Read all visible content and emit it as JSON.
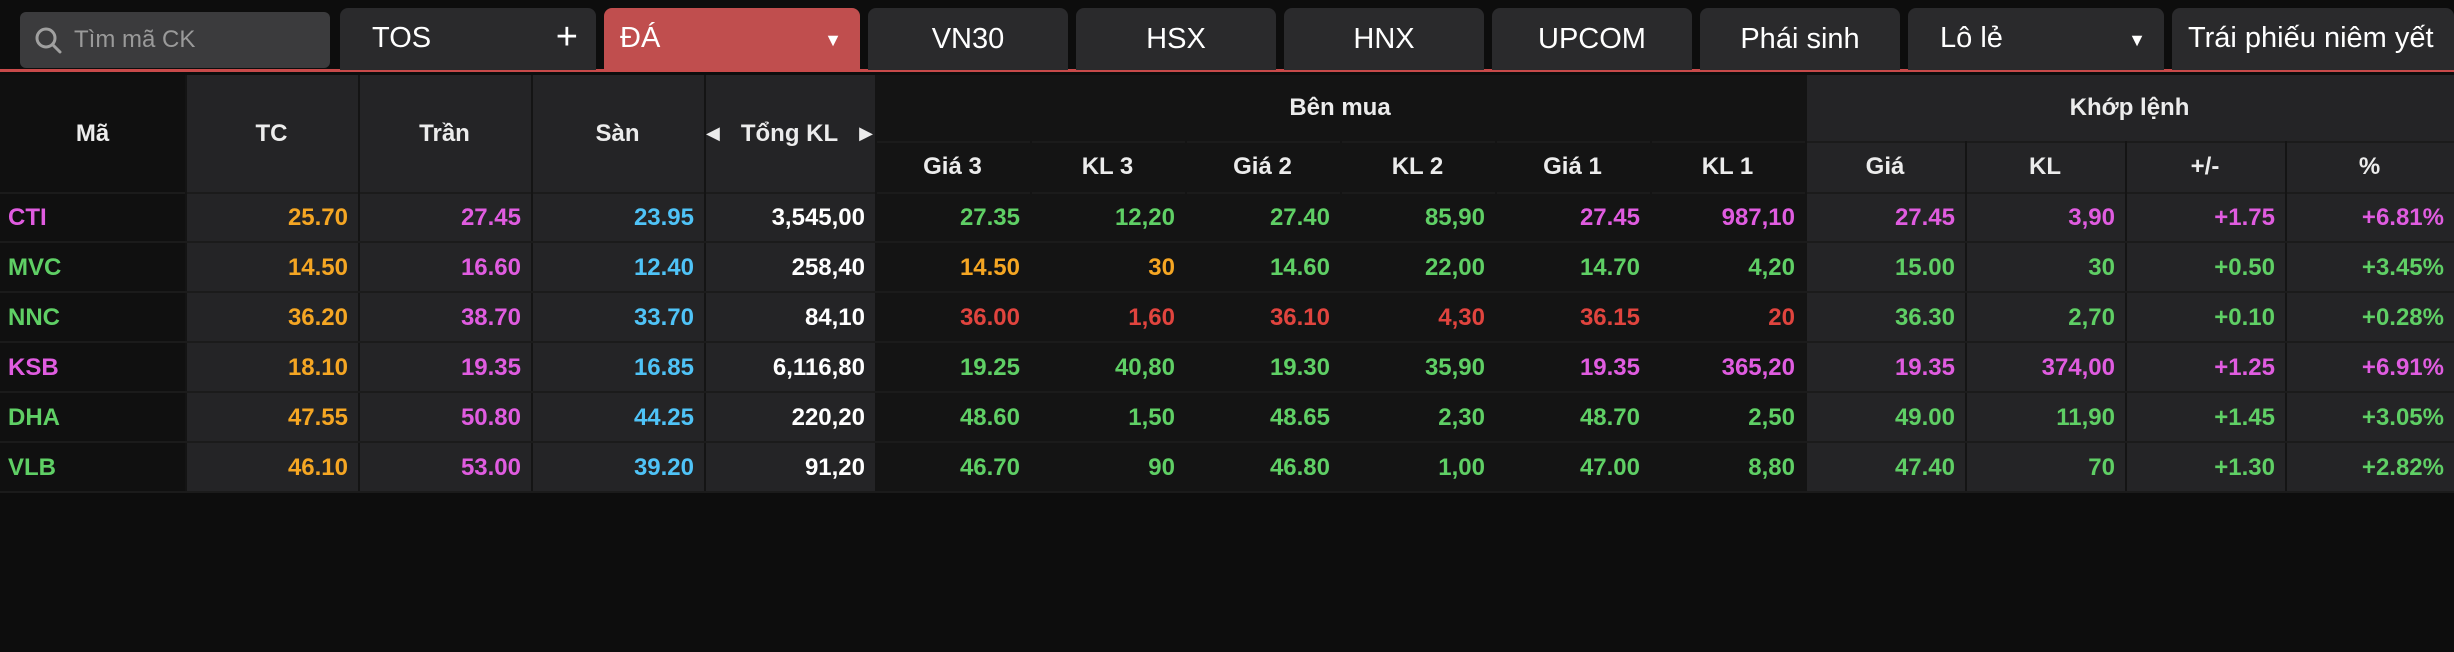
{
  "search": {
    "placeholder": "Tìm mã CK"
  },
  "tabs": [
    {
      "label": "TOS",
      "extra": "+"
    },
    {
      "label": "ĐÁ",
      "extra": "▼"
    },
    {
      "label": "VN30"
    },
    {
      "label": "HSX"
    },
    {
      "label": "HNX"
    },
    {
      "label": "UPCOM"
    },
    {
      "label": "Phái sinh"
    },
    {
      "label": "Lô lẻ",
      "extra": "▼"
    },
    {
      "label": "Trái phiếu niêm yết"
    }
  ],
  "table": {
    "headers": {
      "ma": "Mã",
      "tc": "TC",
      "tran": "Trần",
      "san": "Sàn",
      "tongkl": "Tổng KL",
      "ben_mua": "Bên mua",
      "khop_lenh": "Khớp lệnh",
      "gia3": "Giá 3",
      "kl3": "KL 3",
      "gia2": "Giá 2",
      "kl2": "KL 2",
      "gia1": "Giá 1",
      "kl1": "KL 1",
      "gia": "Giá",
      "kl": "KL",
      "change": "+/-",
      "pct": "%"
    },
    "rows": [
      {
        "sym": "CTI",
        "tc": "25.70",
        "tran": "27.45",
        "san": "23.95",
        "tongkl": "3,545,00",
        "gia3": "27.35",
        "kl3": "12,20",
        "gia2": "27.40",
        "kl2": "85,90",
        "gia1": "27.45",
        "kl1": "987,10",
        "gia": "27.45",
        "kl": "3,90",
        "change": "+1.75",
        "pct": "+6.81%"
      },
      {
        "sym": "MVC",
        "tc": "14.50",
        "tran": "16.60",
        "san": "12.40",
        "tongkl": "258,40",
        "gia3": "14.50",
        "kl3": "30",
        "gia2": "14.60",
        "kl2": "22,00",
        "gia1": "14.70",
        "kl1": "4,20",
        "gia": "15.00",
        "kl": "30",
        "change": "+0.50",
        "pct": "+3.45%"
      },
      {
        "sym": "NNC",
        "tc": "36.20",
        "tran": "38.70",
        "san": "33.70",
        "tongkl": "84,10",
        "gia3": "36.00",
        "kl3": "1,60",
        "gia2": "36.10",
        "kl2": "4,30",
        "gia1": "36.15",
        "kl1": "20",
        "gia": "36.30",
        "kl": "2,70",
        "change": "+0.10",
        "pct": "+0.28%"
      },
      {
        "sym": "KSB",
        "tc": "18.10",
        "tran": "19.35",
        "san": "16.85",
        "tongkl": "6,116,80",
        "gia3": "19.25",
        "kl3": "40,80",
        "gia2": "19.30",
        "kl2": "35,90",
        "gia1": "19.35",
        "kl1": "365,20",
        "gia": "19.35",
        "kl": "374,00",
        "change": "+1.25",
        "pct": "+6.91%"
      },
      {
        "sym": "DHA",
        "tc": "47.55",
        "tran": "50.80",
        "san": "44.25",
        "tongkl": "220,20",
        "gia3": "48.60",
        "kl3": "1,50",
        "gia2": "48.65",
        "kl2": "2,30",
        "gia1": "48.70",
        "kl1": "2,50",
        "gia": "49.00",
        "kl": "11,90",
        "change": "+1.45",
        "pct": "+3.05%"
      },
      {
        "sym": "VLB",
        "tc": "46.10",
        "tran": "53.00",
        "san": "39.20",
        "tongkl": "91,20",
        "gia3": "46.70",
        "kl3": "90",
        "gia2": "46.80",
        "kl2": "1,00",
        "gia1": "47.00",
        "kl1": "8,80",
        "gia": "47.40",
        "kl": "70",
        "change": "+1.30",
        "pct": "+2.82%"
      }
    ]
  },
  "colors": {
    "accent": "#c04e4e",
    "reference": "#f5a623",
    "ceiling": "#e05ce0",
    "floor": "#4fc3f7",
    "up": "#5fcf65",
    "down": "#e0443e",
    "neutral": "#ffffff"
  }
}
